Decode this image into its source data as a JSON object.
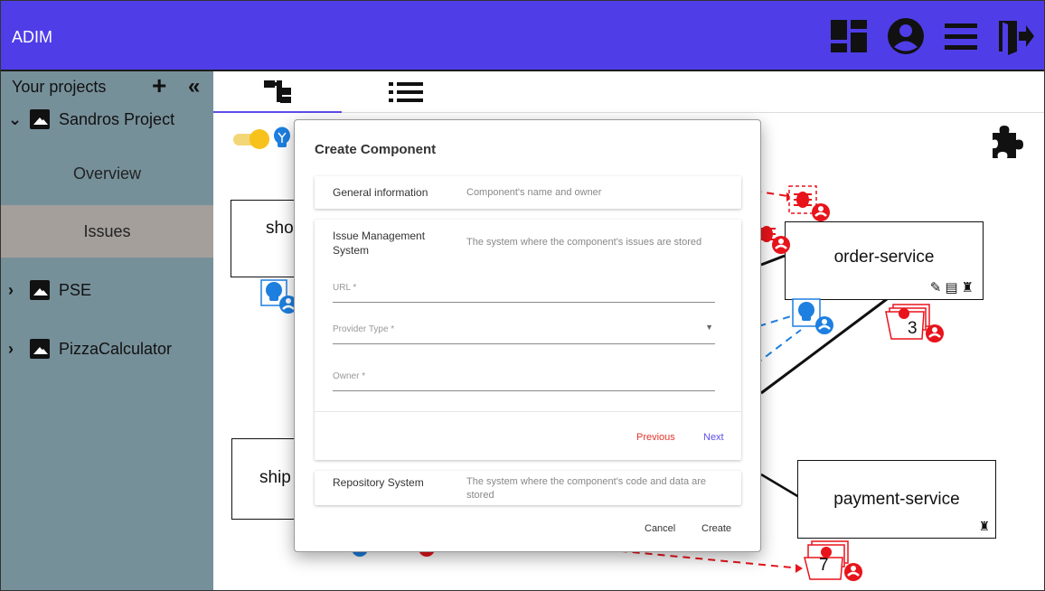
{
  "app": {
    "title": "ADIM"
  },
  "header_icons": [
    "dashboard-icon",
    "account-icon",
    "menu-icon",
    "logout-icon"
  ],
  "sidebar": {
    "title": "Your projects",
    "add_symbol": "+",
    "collapse_symbol": "«",
    "projects": [
      {
        "name": "Sandros Project",
        "expanded": true,
        "children": [
          {
            "label": "Overview",
            "active": false
          },
          {
            "label": "Issues",
            "active": true
          }
        ]
      },
      {
        "name": "PSE",
        "expanded": false
      },
      {
        "name": "PizzaCalculator",
        "expanded": false
      }
    ],
    "colors": {
      "background": "#76909a",
      "active_item": "#a49f9b"
    }
  },
  "tabs": [
    {
      "name": "graph-view-tab",
      "icon": "tree-icon",
      "active": true
    },
    {
      "name": "list-view-tab",
      "icon": "list-icon",
      "active": false
    }
  ],
  "graph": {
    "nodes": {
      "order_service": "order-service",
      "payment_service": "payment-service",
      "partial_1": "sho",
      "partial_2": "ship"
    },
    "counts": {
      "order_issues": "3",
      "payment_issues": "7"
    },
    "colors": {
      "bug": "#e8141b",
      "idea": "#1d7fe0",
      "edge": "#111111"
    }
  },
  "dialog": {
    "title": "Create Component",
    "steps": [
      {
        "title": "General information",
        "description": "Component's name and owner"
      },
      {
        "title": "Issue Management System",
        "description": "The system where the component's issues are stored"
      },
      {
        "title": "Repository System",
        "description": "The system where the component's code and data are stored"
      }
    ],
    "fields": {
      "url": "URL *",
      "provider_type": "Provider Type *",
      "owner": "Owner *"
    },
    "buttons": {
      "previous": "Previous",
      "next": "Next",
      "cancel": "Cancel",
      "create": "Create"
    }
  },
  "colors": {
    "primary": "#4f3ee8",
    "danger": "#e1352b"
  }
}
